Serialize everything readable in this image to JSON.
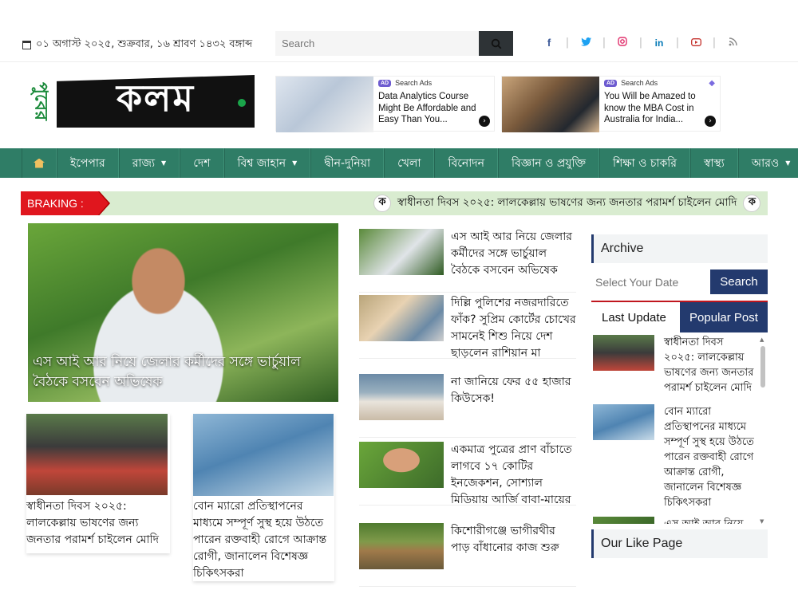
{
  "topbar": {
    "date": "০১ অগাস্ট ২০২৫, শুক্রবার, ১৬ শ্রাবণ ১৪৩২ বঙ্গাব্দ",
    "search_placeholder": "Search",
    "socials": [
      "facebook-icon",
      "twitter-icon",
      "instagram-icon",
      "linkedin-icon",
      "youtube-icon",
      "rss-icon"
    ]
  },
  "logo": {
    "text": "কলম",
    "side_text": "পুবের"
  },
  "ads": [
    {
      "tag": "Search Ads",
      "badge": "AD",
      "text": "Data Analytics Course Might Be Affordable and Easy Than You..."
    },
    {
      "tag": "Search Ads",
      "badge": "AD",
      "text": "You Will be Amazed to know the MBA Cost in Australia for India..."
    }
  ],
  "nav": {
    "items": [
      "ইপেপার",
      "রাজ্য",
      "দেশ",
      "বিশ্ব জাহান",
      "দ্বীন-দুনিয়া",
      "খেলা",
      "বিনোদন",
      "বিজ্ঞান ও প্রযুক্তি",
      "শিক্ষা ও চাকরি",
      "স্বাস্থ্য",
      "আরও"
    ]
  },
  "breaking": {
    "label": "BRAKING :",
    "text": "স্বাধীনতা দিবস ২০২৫: লালকেল্লায় ভাষণের জন্য জনতার পরামর্শ চাইলেন মোদি"
  },
  "lead": {
    "title": "এস আই আর নিয়ে জেলার কর্মীদের সঙ্গে ভার্চুয়াল বৈঠকে বসবেন অভিষেক"
  },
  "cards": [
    {
      "title": "স্বাধীনতা দিবস ২০২৫: লালকেল্লায় ভাষণের জন্য জনতার পরামর্শ চাইলেন মোদি"
    },
    {
      "title": "বোন ম্যারো প্রতিস্থাপনের মাধ্যমে সম্পূর্ণ সুস্থ হয়ে উঠতে পারেন রক্তবাহী রোগে আক্রান্ত রোগী, জানালেন বিশেষজ্ঞ চিকিৎসকরা"
    }
  ],
  "middle": [
    {
      "title": "এস আই আর নিয়ে জেলার কর্মীদের সঙ্গে ভার্চুয়াল বৈঠকে বসবেন অভিষেক"
    },
    {
      "title": "দিল্লি পুলিশের নজরদারিতে ফাঁক? সুপ্রিম কোর্টের চোখের সামনেই শিশু নিয়ে দেশ ছাড়লেন রাশিয়ান মা"
    },
    {
      "title": "না জানিয়ে ফের ৫৫ হাজার কিউসেক!"
    },
    {
      "title": "একমাত্র পুত্রের প্রাণ বাঁচাতে লাগবে ১৭ কোটির ইনজেকশন, সোশ্যাল মিডিয়ায় আর্জি বাবা-মায়ের"
    },
    {
      "title": "কিশোরীগঞ্জে ভাগীরথীর পাড় বাঁধানোর কাজ শুরু"
    }
  ],
  "sidebar": {
    "archive_title": "Archive",
    "date_placeholder": "Select Your Date",
    "search_button": "Search",
    "tab_last": "Last Update",
    "tab_popular": "Popular Post",
    "items": [
      {
        "title": "স্বাধীনতা দিবস ২০২৫: লালকেল্লায় ভাষণের জন্য জনতার পরামর্শ চাইলেন মোদি"
      },
      {
        "title": "বোন ম্যারো প্রতিস্থাপনের মাধ্যমে সম্পূর্ণ সুস্থ হয়ে উঠতে পারেন রক্তবাহী রোগে আক্রান্ত রোগী, জানালেন বিশেষজ্ঞ চিকিৎসকরা"
      },
      {
        "title": "এস আই আর নিয়ে"
      }
    ],
    "like_title": "Our Like Page"
  },
  "colors": {
    "nav": "#2f7d66",
    "breaking_red": "#e0161e",
    "navy": "#233a6e",
    "ticker_bg": "#d9ecd0"
  }
}
